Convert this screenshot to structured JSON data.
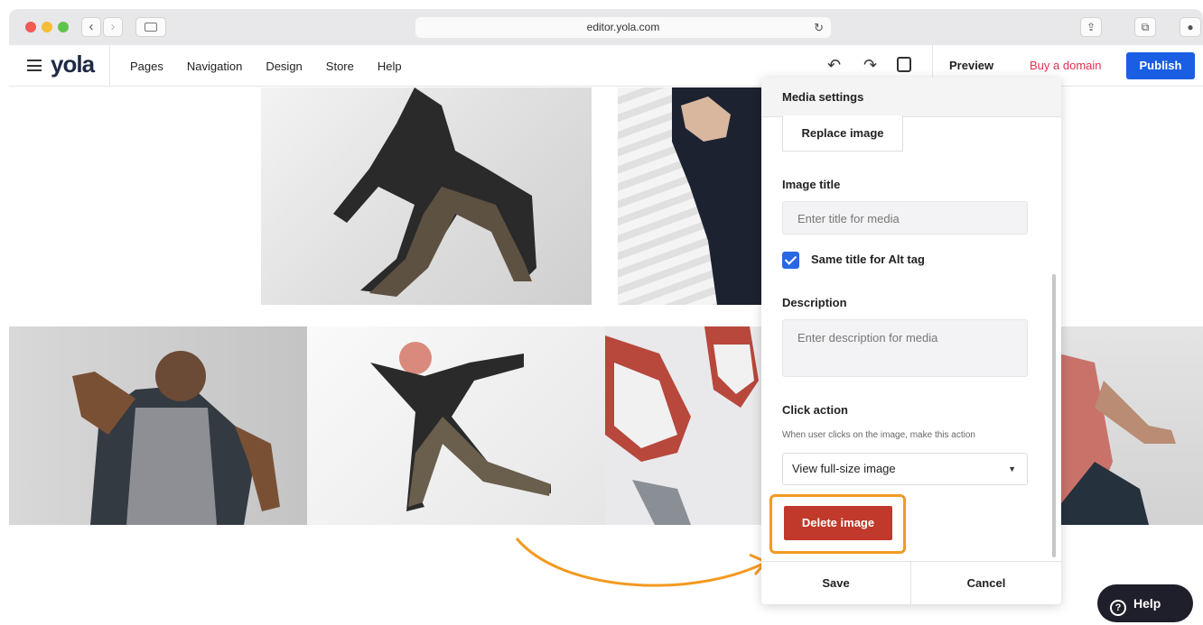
{
  "browser": {
    "url": "editor.yola.com",
    "back_glyph": "‹",
    "forward_glyph": "›",
    "reload_glyph": "↻",
    "share_glyph": "⇪",
    "tabs_glyph": "⧉",
    "download_glyph": "●"
  },
  "header": {
    "logo": "yola",
    "nav": [
      "Pages",
      "Navigation",
      "Design",
      "Store",
      "Help"
    ],
    "undo_glyph": "↶",
    "redo_glyph": "↷",
    "preview_label": "Preview",
    "buy_domain_label": "Buy a domain",
    "publish_label": "Publish"
  },
  "panel": {
    "title": "Media settings",
    "replace_label": "Replace image",
    "image_title_label": "Image title",
    "image_title_placeholder": "Enter title for media",
    "same_title_label": "Same title for Alt tag",
    "same_title_checked": true,
    "description_label": "Description",
    "description_placeholder": "Enter description for media",
    "click_action_label": "Click action",
    "click_action_hint": "When user clicks on the image, make this action",
    "click_action_value": "View full-size image",
    "caret_glyph": "▼",
    "delete_label": "Delete image",
    "save_label": "Save",
    "cancel_label": "Cancel"
  },
  "help": {
    "label": "Help",
    "icon_glyph": "?"
  },
  "colors": {
    "publish": "#1a5ee3",
    "buy_domain": "#e2314e",
    "delete": "#c0392b",
    "highlight": "#f39a1f",
    "checkbox": "#2867e6"
  }
}
